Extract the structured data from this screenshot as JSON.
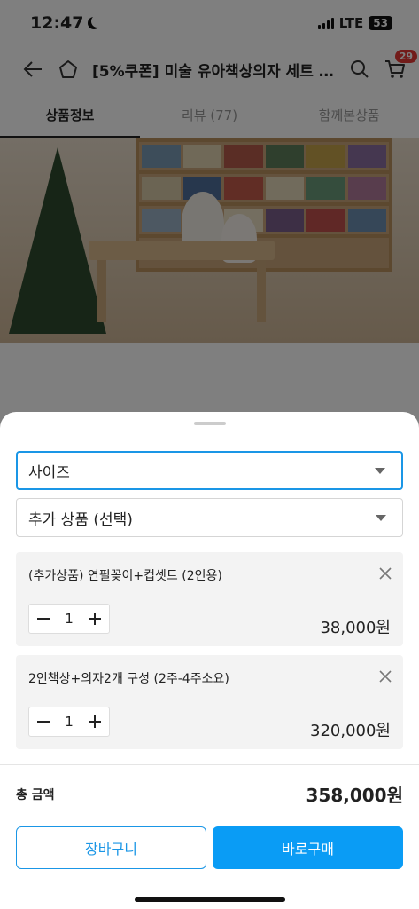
{
  "status_bar": {
    "time": "12:47",
    "network": "LTE",
    "battery": "53"
  },
  "nav": {
    "title": "[5%쿠폰] 미술 유아책상의자 세트 (2…",
    "cart_count": "29"
  },
  "tabs": [
    {
      "label": "상품정보",
      "active": true
    },
    {
      "label": "리뷰 (77)",
      "active": false
    },
    {
      "label": "함께본상품",
      "active": false
    }
  ],
  "sheet": {
    "size_select": {
      "label": "사이즈"
    },
    "addon_select": {
      "label": "추가 상품 (선택)"
    },
    "items": [
      {
        "name": "(추가상품) 연필꽂이+컵셋트 (2인용)",
        "qty": "1",
        "price": "38,000원"
      },
      {
        "name": "2인책상+의자2개 구성 (2주-4주소요)",
        "qty": "1",
        "price": "320,000원"
      }
    ],
    "total_label": "총 금액",
    "total_value": "358,000원",
    "cart_button": "장바구니",
    "buy_button": "바로구매"
  },
  "colors": {
    "accent": "#0a9cf5",
    "badge": "#e53935"
  }
}
